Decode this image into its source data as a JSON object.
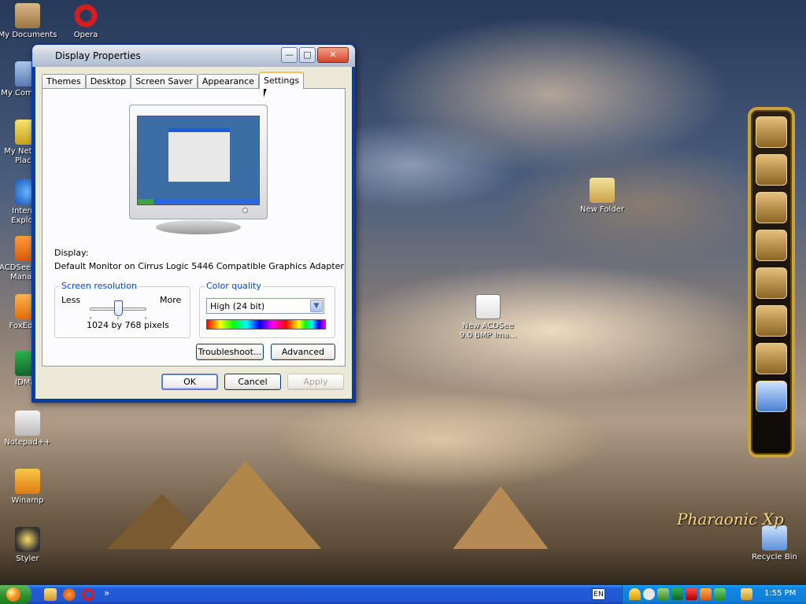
{
  "desktop": {
    "icons": [
      {
        "label": "My Documents",
        "icon": "my-documents-icon"
      },
      {
        "label": "Opera",
        "icon": "opera-icon"
      },
      {
        "label": "My Computer",
        "icon": "my-computer-icon"
      },
      {
        "label": "My Network Places",
        "icon": "network-places-icon"
      },
      {
        "label": "Internet Explorer",
        "icon": "internet-explorer-icon"
      },
      {
        "label": "ACDSee Photo Manager",
        "icon": "acdsee-icon"
      },
      {
        "label": "FoxEditor",
        "icon": "foxeditor-icon"
      },
      {
        "label": "IDMan",
        "icon": "idm-icon"
      },
      {
        "label": "Notepad++",
        "icon": "notepad-plus-plus-icon"
      },
      {
        "label": "Winamp",
        "icon": "winamp-icon"
      },
      {
        "label": "Styler",
        "icon": "styler-icon"
      },
      {
        "label": "New Folder",
        "icon": "folder-icon"
      },
      {
        "label": "New ACDSee 9.0 BMP Ima...",
        "icon": "bmp-file-icon"
      },
      {
        "label": "Recycle Bin",
        "icon": "recycle-bin-icon"
      }
    ],
    "logo_text": "Pharaonic Xp"
  },
  "window": {
    "title": "Display Properties",
    "tabs": [
      {
        "label": "Themes"
      },
      {
        "label": "Desktop"
      },
      {
        "label": "Screen Saver"
      },
      {
        "label": "Appearance"
      },
      {
        "label": "Settings",
        "active": true
      }
    ],
    "display_label": "Display:",
    "display_value": "Default Monitor on Cirrus Logic 5446 Compatible Graphics Adapter",
    "resolution": {
      "group_title": "Screen resolution",
      "less_label": "Less",
      "more_label": "More",
      "value_text": "1024 by 768 pixels",
      "slider_position": 0.5
    },
    "color_quality": {
      "group_title": "Color quality",
      "selected": "High (24 bit)"
    },
    "buttons": {
      "troubleshoot": "Troubleshoot...",
      "advanced": "Advanced",
      "ok": "OK",
      "cancel": "Cancel",
      "apply": "Apply"
    },
    "title_buttons": {
      "minimize": "—",
      "maximize": "□",
      "close": "✕"
    }
  },
  "taskbar": {
    "language": "EN",
    "clock": "1:55 PM",
    "quick_launch_more": "»"
  }
}
